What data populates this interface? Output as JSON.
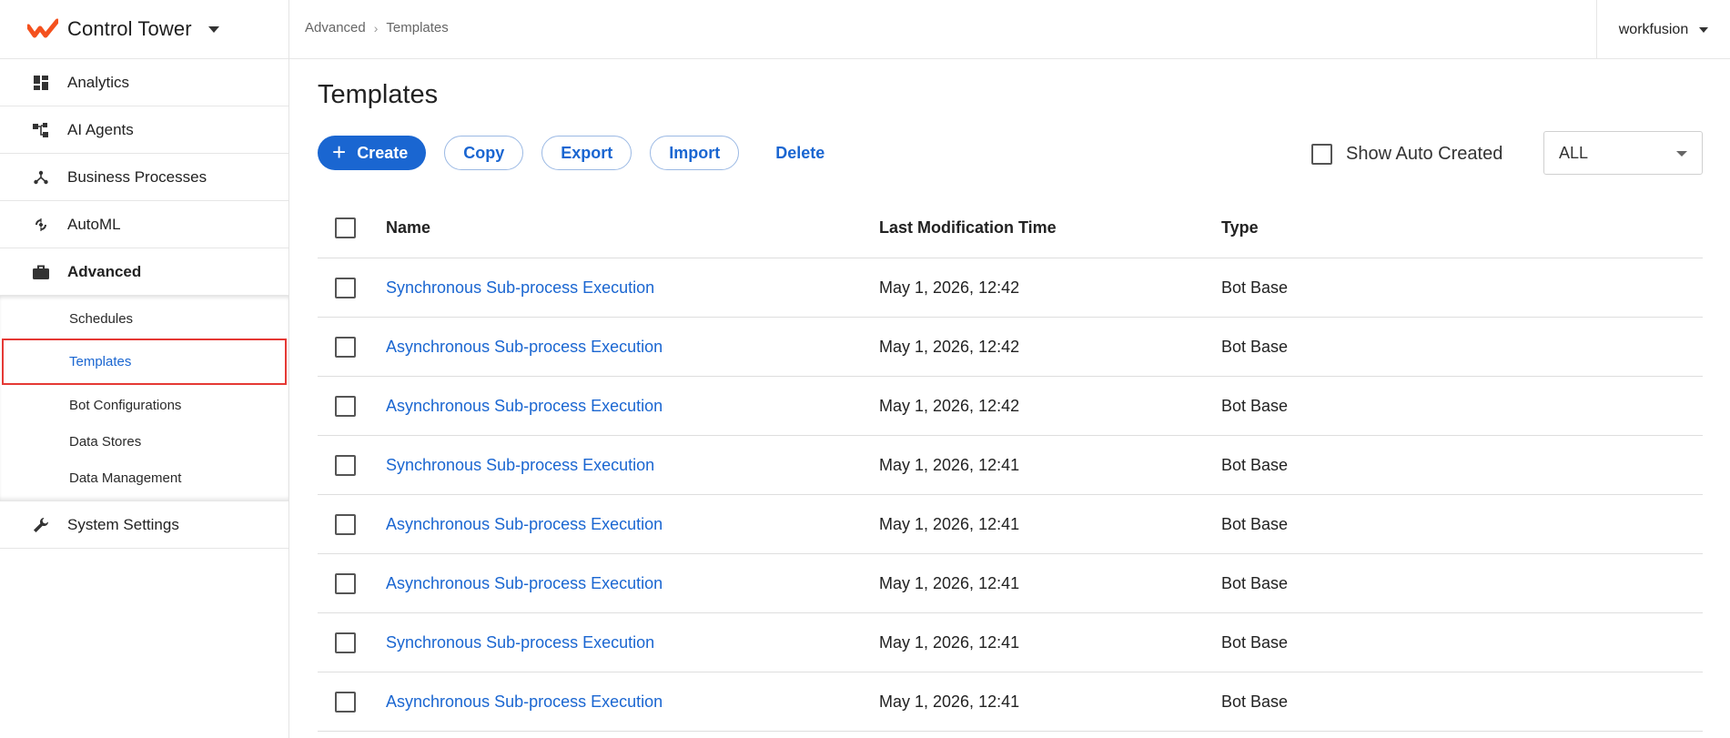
{
  "app": {
    "title": "Control Tower",
    "accent_color": "#1a66d1",
    "logo_color": "#f4511e"
  },
  "sidebar": {
    "items": [
      {
        "label": "Analytics",
        "icon": "dashboard-icon"
      },
      {
        "label": "AI Agents",
        "icon": "hierarchy-icon"
      },
      {
        "label": "Business Processes",
        "icon": "process-icon"
      },
      {
        "label": "AutoML",
        "icon": "automl-icon"
      },
      {
        "label": "Advanced",
        "icon": "briefcase-icon",
        "active": true
      }
    ],
    "subitems": [
      {
        "label": "Schedules"
      },
      {
        "label": "Templates",
        "selected": true
      },
      {
        "label": "Bot Configurations"
      },
      {
        "label": "Data Stores"
      },
      {
        "label": "Data Management"
      }
    ],
    "bottom_item": {
      "label": "System Settings",
      "icon": "wrench-icon"
    }
  },
  "topbar": {
    "breadcrumb": [
      "Advanced",
      "Templates"
    ],
    "user": "workfusion"
  },
  "page": {
    "title": "Templates"
  },
  "toolbar": {
    "create_label": "Create",
    "copy_label": "Copy",
    "export_label": "Export",
    "import_label": "Import",
    "delete_label": "Delete",
    "show_auto_created_label": "Show Auto Created",
    "filter_value": "ALL"
  },
  "table": {
    "columns": [
      "Name",
      "Last Modification Time",
      "Type"
    ],
    "rows": [
      {
        "name": "Synchronous Sub-process Execution",
        "time": "May 1, 2026, 12:42",
        "type": "Bot Base"
      },
      {
        "name": "Asynchronous Sub-process Execution",
        "time": "May 1, 2026, 12:42",
        "type": "Bot Base"
      },
      {
        "name": "Asynchronous Sub-process Execution",
        "time": "May 1, 2026, 12:42",
        "type": "Bot Base"
      },
      {
        "name": "Synchronous Sub-process Execution",
        "time": "May 1, 2026, 12:41",
        "type": "Bot Base"
      },
      {
        "name": "Asynchronous Sub-process Execution",
        "time": "May 1, 2026, 12:41",
        "type": "Bot Base"
      },
      {
        "name": "Asynchronous Sub-process Execution",
        "time": "May 1, 2026, 12:41",
        "type": "Bot Base"
      },
      {
        "name": "Synchronous Sub-process Execution",
        "time": "May 1, 2026, 12:41",
        "type": "Bot Base"
      },
      {
        "name": "Asynchronous Sub-process Execution",
        "time": "May 1, 2026, 12:41",
        "type": "Bot Base"
      }
    ]
  }
}
